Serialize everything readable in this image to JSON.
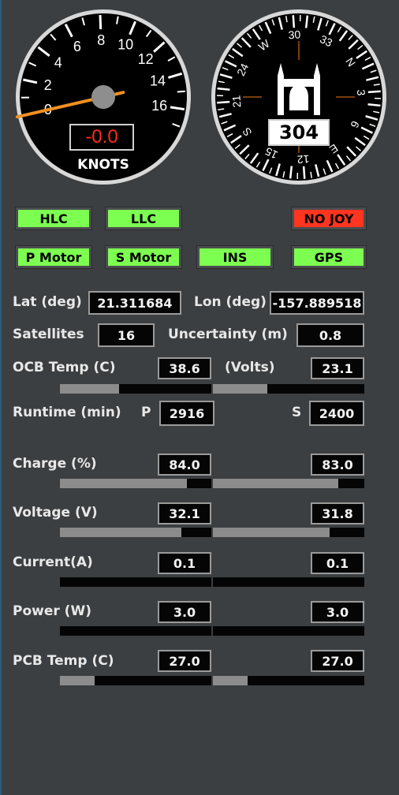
{
  "speed_gauge": {
    "ticks": [
      "0",
      "2",
      "4",
      "6",
      "8",
      "10",
      "12",
      "14",
      "16"
    ],
    "readout": "-0.0",
    "unit": "KNOTS",
    "needle_value": 0.0,
    "readout_color": "#ff2a1a"
  },
  "compass": {
    "labels": [
      "N",
      "3",
      "6",
      "E",
      "12",
      "15",
      "S",
      "21",
      "24",
      "W",
      "30",
      "33"
    ],
    "heading": "304"
  },
  "status": {
    "hlc": "HLC",
    "llc": "LLC",
    "no_joy": "NO JOY",
    "p_motor": "P Motor",
    "s_motor": "S Motor",
    "ins": "INS",
    "gps": "GPS",
    "on_color": "#7dff52",
    "off_color": "#ff3520"
  },
  "nav": {
    "lat_label": "Lat (deg)",
    "lat_value": "21.311684",
    "lon_label": "Lon (deg)",
    "lon_value": "-157.889518",
    "sat_label": "Satellites",
    "sat_value": "16",
    "unc_label": "Uncertainty (m)",
    "unc_value": "0.8"
  },
  "ocb": {
    "temp_label": "OCB Temp (C)",
    "temp_value": "38.6",
    "temp_level": 0.39,
    "volts_label": "(Volts)",
    "volts_value": "23.1",
    "volts_level": 0.36
  },
  "runtime": {
    "label": "Runtime (min)",
    "p_label": "P",
    "p_value": "2916",
    "s_label": "S",
    "s_value": "2400"
  },
  "battery": {
    "charge_label": "Charge (%)",
    "charge_p": "84.0",
    "charge_s": "83.0",
    "charge_p_level": 0.84,
    "charge_s_level": 0.83,
    "voltage_label": "Voltage (V)",
    "voltage_p": "32.1",
    "voltage_s": "31.8",
    "voltage_p_level": 0.8,
    "voltage_s_level": 0.77,
    "current_label": "Current(A)",
    "current_p": "0.1",
    "current_s": "0.1",
    "current_p_level": 0.0,
    "current_s_level": 0.0,
    "power_label": "Power (W)",
    "power_p": "3.0",
    "power_s": "3.0",
    "power_p_level": 0.0,
    "power_s_level": 0.0,
    "pcb_label": "PCB Temp (C)",
    "pcb_p": "27.0",
    "pcb_s": "27.0",
    "pcb_p_level": 0.23,
    "pcb_s_level": 0.23
  }
}
